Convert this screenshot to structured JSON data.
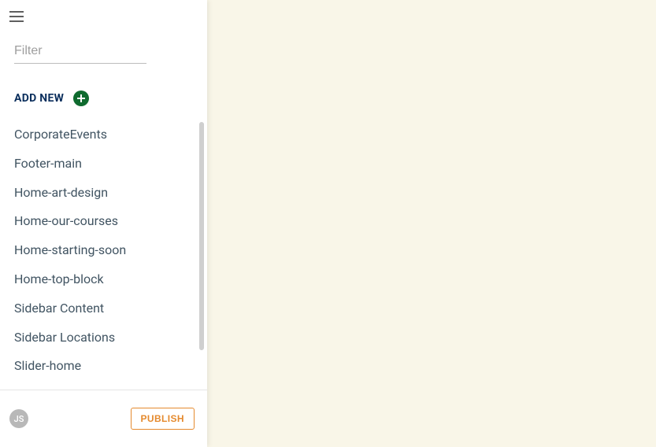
{
  "filter": {
    "placeholder": "Filter",
    "value": ""
  },
  "addNew": {
    "label": "ADD NEW"
  },
  "items": [
    {
      "label": "CorporateEvents"
    },
    {
      "label": "Footer-main"
    },
    {
      "label": "Home-art-design"
    },
    {
      "label": "Home-our-courses"
    },
    {
      "label": "Home-starting-soon"
    },
    {
      "label": "Home-top-block"
    },
    {
      "label": "Sidebar Content"
    },
    {
      "label": "Sidebar Locations"
    },
    {
      "label": "Slider-home"
    }
  ],
  "footer": {
    "avatar_initials": "JS",
    "publish_label": "PUBLISH"
  }
}
